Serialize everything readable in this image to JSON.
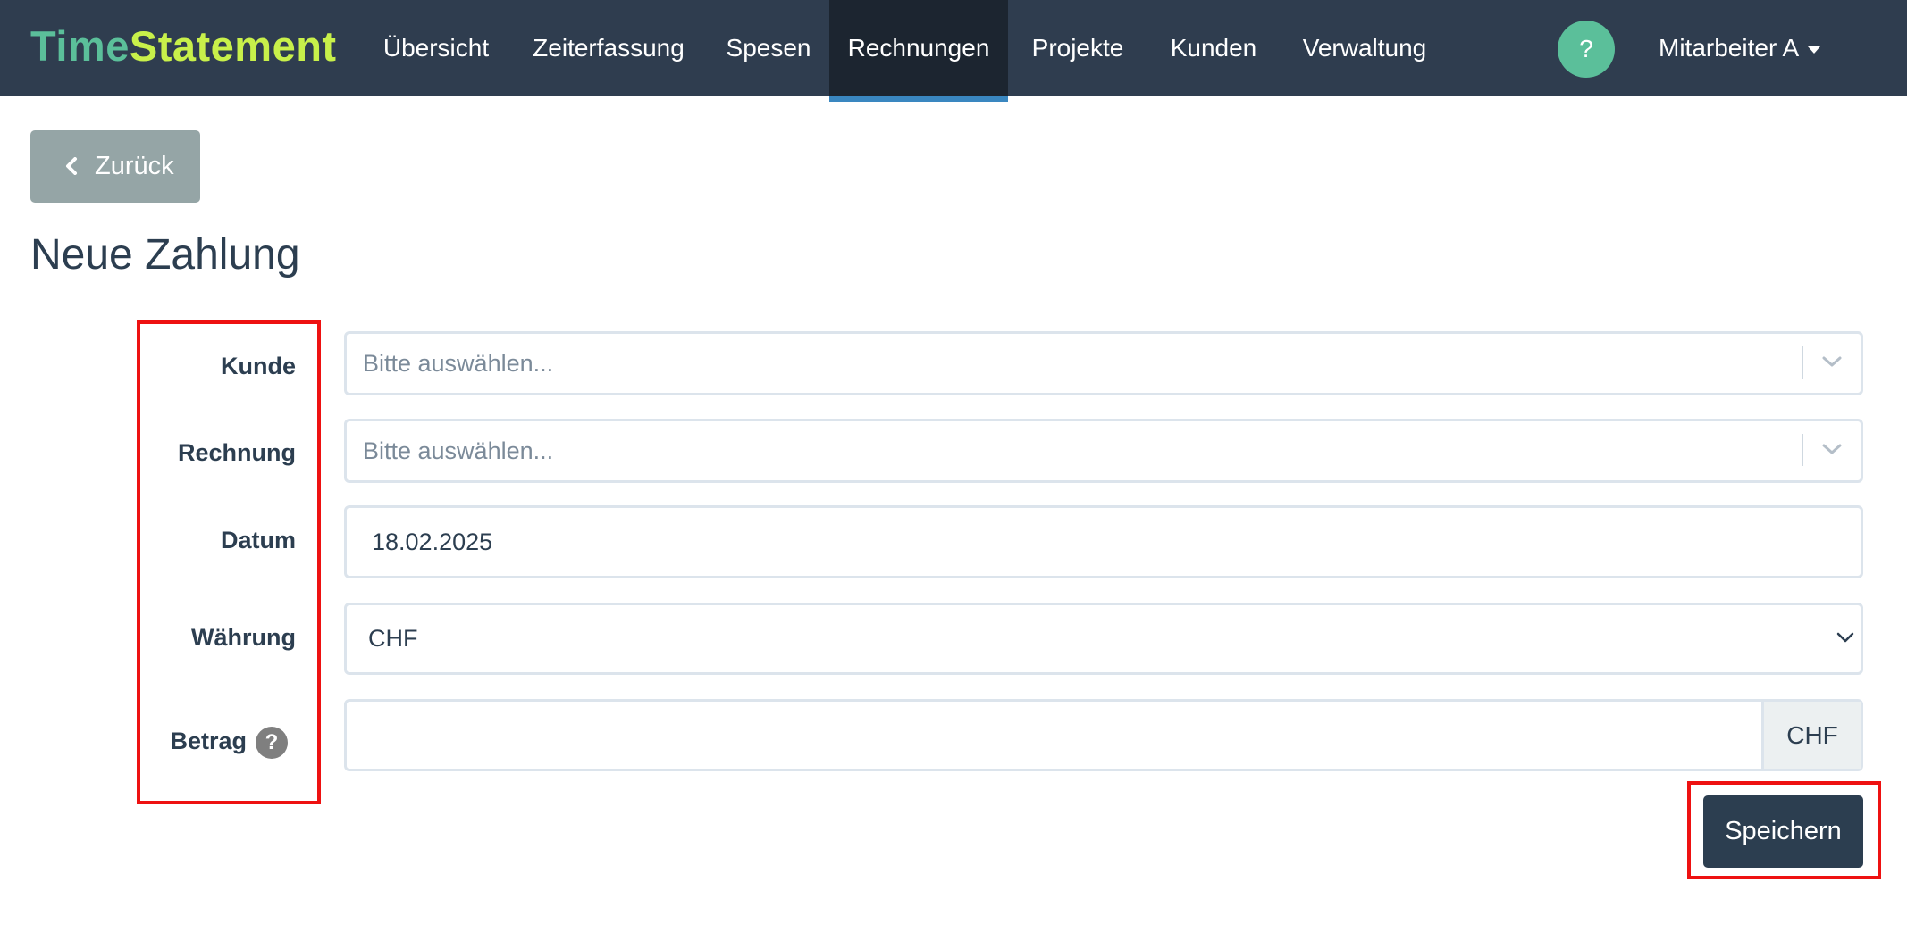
{
  "brand": {
    "part1": "Time",
    "part2": "Statement"
  },
  "nav": {
    "items": [
      {
        "label": "Übersicht"
      },
      {
        "label": "Zeiterfassung"
      },
      {
        "label": "Spesen"
      },
      {
        "label": "Rechnungen",
        "active": true
      },
      {
        "label": "Projekte"
      },
      {
        "label": "Kunden"
      },
      {
        "label": "Verwaltung"
      }
    ],
    "help_label": "?",
    "user_label": "Mitarbeiter A"
  },
  "back_button": {
    "label": "Zurück"
  },
  "page_title": "Neue Zahlung",
  "form": {
    "kunde": {
      "label": "Kunde",
      "placeholder": "Bitte auswählen..."
    },
    "rechnung": {
      "label": "Rechnung",
      "placeholder": "Bitte auswählen..."
    },
    "datum": {
      "label": "Datum",
      "value": "18.02.2025"
    },
    "waehrung": {
      "label": "Währung",
      "value": "CHF"
    },
    "betrag": {
      "label": "Betrag",
      "help": "?",
      "value": "",
      "addon": "CHF"
    }
  },
  "save_button": {
    "label": "Speichern"
  },
  "colors": {
    "navbar": "#2f3d4f",
    "nav_active": "#1c2530",
    "nav_underline": "#3a87c0",
    "brand_time": "#5bbf9a",
    "brand_statement": "#c8f04a",
    "back_button": "#95a5a6",
    "save_button": "#2c3e50",
    "highlight": "#ee1111"
  },
  "icons": {
    "back": "chevron-left-icon",
    "select": "chevron-down-icon",
    "help": "question-mark-icon",
    "user_menu": "caret-down-icon"
  }
}
